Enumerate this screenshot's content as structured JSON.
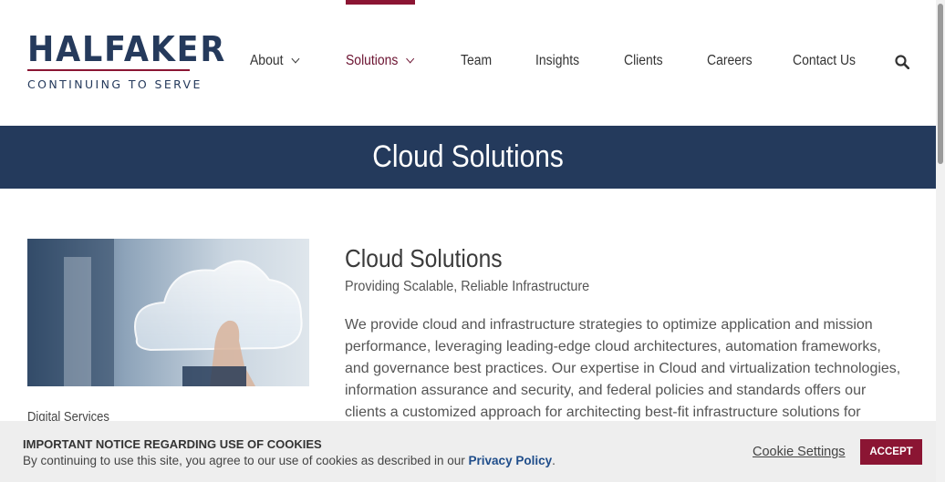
{
  "logo": {
    "name": "HALFAKER",
    "tagline": "CONTINUING TO SERVE"
  },
  "nav": {
    "items": [
      {
        "label": "About",
        "dropdown": true
      },
      {
        "label": "Solutions",
        "dropdown": true,
        "active": true
      },
      {
        "label": "Team"
      },
      {
        "label": "Insights"
      },
      {
        "label": "Clients"
      },
      {
        "label": "Careers"
      },
      {
        "label": "Contact Us"
      }
    ],
    "search_icon": "search-icon"
  },
  "banner": {
    "title": "Cloud Solutions"
  },
  "sidebar": {
    "label": "Digital Services"
  },
  "main": {
    "title": "Cloud Solutions",
    "subtitle": "Providing Scalable, Reliable Infrastructure",
    "body": "We provide cloud and infrastructure strategies to optimize application and mission performance, leveraging leading-edge cloud architectures, automation frameworks, and governance best practices. Our expertise in Cloud and virtualization technologies, information assurance and security, and federal policies and standards offers our clients a customized approach for architecting best-fit infrastructure solutions for"
  },
  "cookie": {
    "title": "IMPORTANT NOTICE REGARDING USE OF COOKIES",
    "text_before": "By continuing to use this site, you agree to our use of cookies as described in our ",
    "link": "Privacy Policy",
    "text_after": ".",
    "settings": "Cookie Settings",
    "accept": "ACCEPT"
  },
  "colors": {
    "brand_navy": "#243a5c",
    "brand_maroon": "#8b1533",
    "link_blue": "#1f4d8a"
  }
}
